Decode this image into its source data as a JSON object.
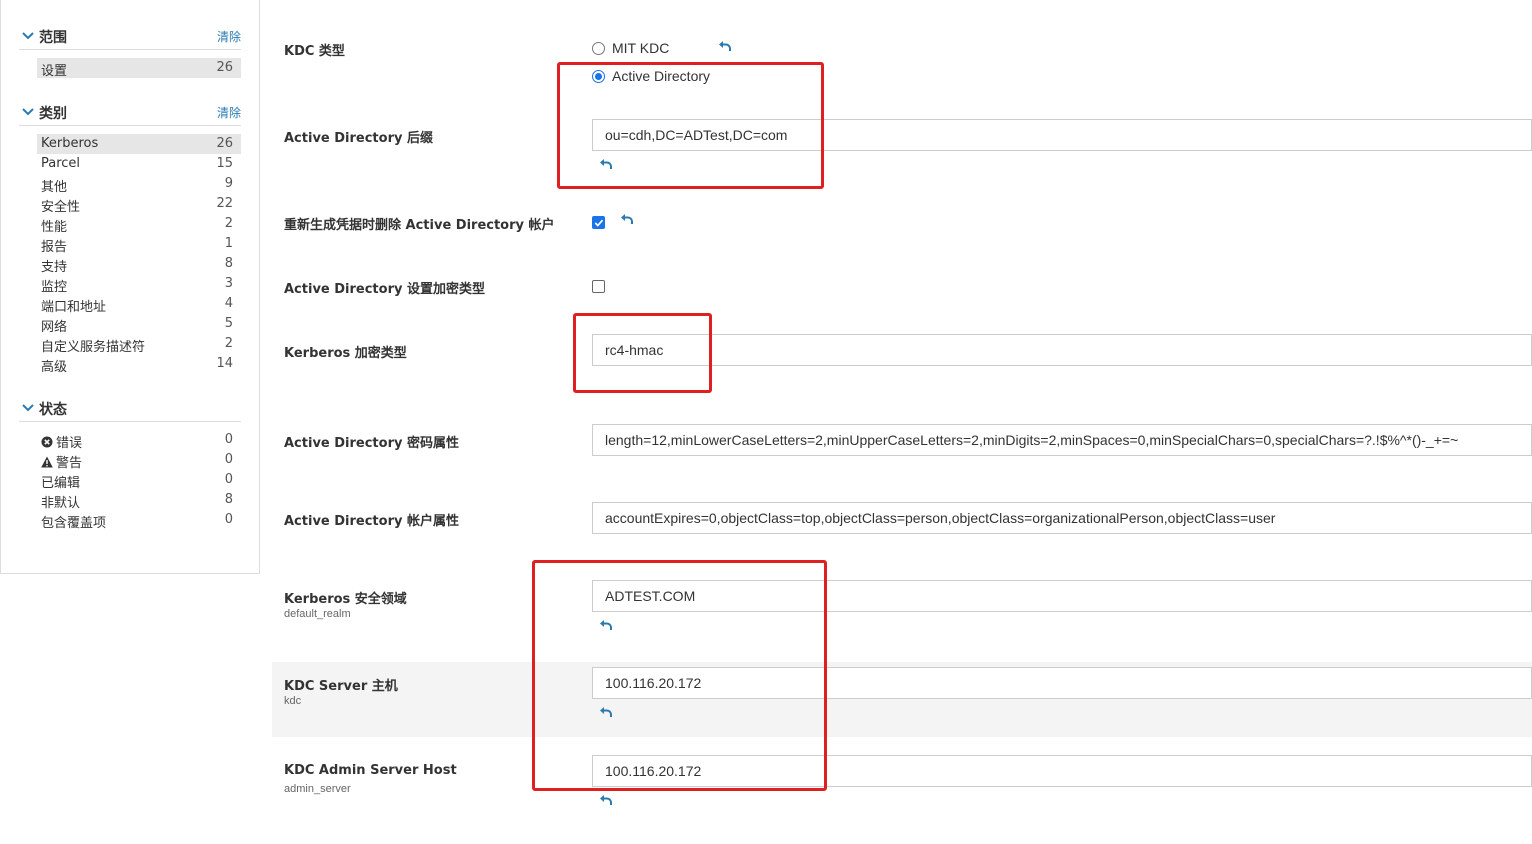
{
  "sidebar": {
    "scope": {
      "title": "范围",
      "clear": "清除",
      "items": [
        {
          "label": "设置",
          "count": "26"
        }
      ]
    },
    "category": {
      "title": "类别",
      "clear": "清除",
      "items": [
        {
          "label": "Kerberos",
          "count": "26"
        },
        {
          "label": "Parcel",
          "count": "15"
        },
        {
          "label": "其他",
          "count": "9"
        },
        {
          "label": "安全性",
          "count": "22"
        },
        {
          "label": "性能",
          "count": "2"
        },
        {
          "label": "报告",
          "count": "1"
        },
        {
          "label": "支持",
          "count": "8"
        },
        {
          "label": "监控",
          "count": "3"
        },
        {
          "label": "端口和地址",
          "count": "4"
        },
        {
          "label": "网络",
          "count": "5"
        },
        {
          "label": "自定义服务描述符",
          "count": "2"
        },
        {
          "label": "高级",
          "count": "14"
        }
      ]
    },
    "status": {
      "title": "状态",
      "items": [
        {
          "label": "错误",
          "count": "0",
          "icon": "error-icon"
        },
        {
          "label": "警告",
          "count": "0",
          "icon": "warning-icon"
        },
        {
          "label": "已编辑",
          "count": "0"
        },
        {
          "label": "非默认",
          "count": "8"
        },
        {
          "label": "包含覆盖项",
          "count": "0"
        }
      ]
    }
  },
  "settings": {
    "kdc_type": {
      "label": "KDC 类型",
      "options": [
        "MIT KDC",
        "Active Directory"
      ],
      "selected": "Active Directory"
    },
    "ad_suffix": {
      "label": "Active Directory 后缀",
      "value": "ou=cdh,DC=ADTest,DC=com"
    },
    "ad_delete": {
      "label": "重新生成凭据时删除 Active Directory 帐户",
      "checked": true
    },
    "ad_set_enc": {
      "label": "Active Directory 设置加密类型",
      "checked": false
    },
    "krb_enc": {
      "label": "Kerberos 加密类型",
      "value": "rc4-hmac"
    },
    "ad_pwd": {
      "label": "Active Directory 密码属性",
      "value": "length=12,minLowerCaseLetters=2,minUpperCaseLetters=2,minDigits=2,minSpaces=0,minSpecialChars=0,specialChars=?.!$%^*()-_+=~"
    },
    "ad_acct": {
      "label": "Active Directory 帐户属性",
      "value": "accountExpires=0,objectClass=top,objectClass=person,objectClass=organizationalPerson,objectClass=user"
    },
    "realm": {
      "label": "Kerberos 安全领域",
      "sub": "default_realm",
      "value": "ADTEST.COM"
    },
    "kdc_host": {
      "label": "KDC Server 主机",
      "sub": "kdc",
      "value": "100.116.20.172"
    },
    "admin_host": {
      "label": "KDC Admin Server Host",
      "sub": "admin_server",
      "value": "100.116.20.172"
    }
  },
  "colors": {
    "accent": "#1a73e8",
    "link": "#2a7ab0",
    "highlight_box": "#e02020"
  }
}
